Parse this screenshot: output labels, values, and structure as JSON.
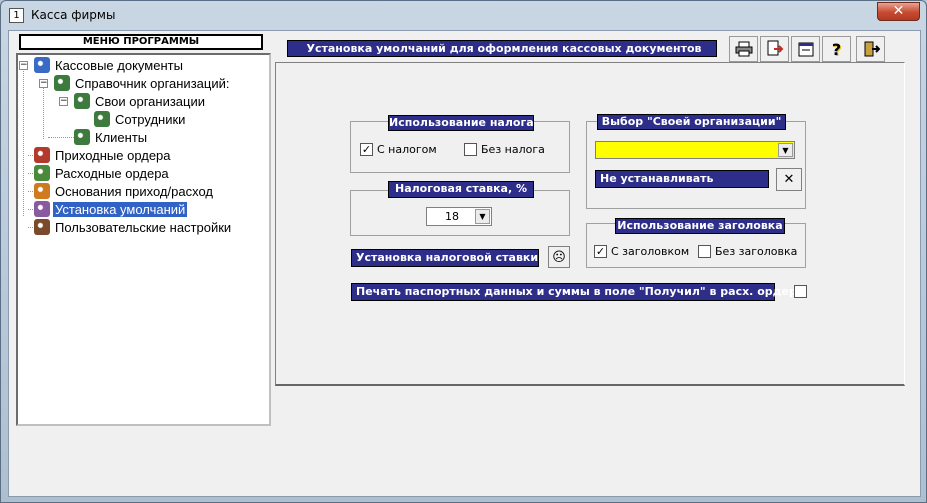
{
  "window": {
    "title": "Касса фирмы",
    "close_glyph": "✕",
    "app_icon_glyph": "1"
  },
  "menu": {
    "header": "МЕНЮ ПРОГРАММЫ",
    "items": [
      {
        "label": "Кассовые документы",
        "icon": "users-icon",
        "color": "#3a6bc4"
      },
      {
        "label": "Справочник организаций:",
        "icon": "gear-group-icon",
        "color": "#3d7a3d"
      },
      {
        "label": "Свои организации",
        "icon": "gear-group-icon",
        "color": "#3d7a3d"
      },
      {
        "label": "Сотрудники",
        "icon": "gear-group-icon",
        "color": "#3d7a3d"
      },
      {
        "label": "Клиенты",
        "icon": "gear-group-icon",
        "color": "#3d7a3d"
      },
      {
        "label": "Приходные ордера",
        "icon": "person-in-icon",
        "color": "#b33a2a"
      },
      {
        "label": "Расходные ордера",
        "icon": "person-out-icon",
        "color": "#4a8a3a"
      },
      {
        "label": "Основания приход/расход",
        "icon": "person-gear-icon",
        "color": "#d07a20"
      },
      {
        "label": "Установка умолчаний",
        "icon": "person-settings-icon",
        "color": "#8a5aa0"
      },
      {
        "label": "Пользовательские настройки",
        "icon": "book-icon",
        "color": "#7a4a2a"
      }
    ]
  },
  "header": {
    "title": "Установка умолчаний для оформления кассовых документов"
  },
  "toolbar": [
    "printer-icon",
    "export-icon",
    "properties-icon",
    "help-icon",
    "exit-icon"
  ],
  "toolbar_glyphs": {
    "help": "?"
  },
  "tax_usage": {
    "title": "Использование налога",
    "with_tax": {
      "label": "С налогом",
      "checked": true
    },
    "without_tax": {
      "label": "Без налога",
      "checked": false
    }
  },
  "tax_rate": {
    "title": "Налоговая ставка, %",
    "value": "18"
  },
  "set_tax_rate": {
    "label": "Установка налоговой ставки",
    "icon": "sad-face-icon",
    "glyph": "☹"
  },
  "own_org": {
    "title": "Выбор \"Своей организации\"",
    "value": "",
    "field_color": "#ffff00",
    "reset_label": "Не устанавливать",
    "reset_glyph": "✕"
  },
  "header_usage": {
    "title": "Использование заголовка",
    "with_header": {
      "label": "С заголовком",
      "checked": true
    },
    "without_header": {
      "label": "Без заголовка",
      "checked": false
    }
  },
  "passport": {
    "label": "Печать паспортных данных и суммы в поле \"Получил\" в расх. ордере",
    "checked": false
  },
  "colors": {
    "accent": "#2d2d8a",
    "selection": "#3163c5",
    "close": "#c74a31"
  },
  "check_mark": "✓",
  "combo_arrow": "▼"
}
